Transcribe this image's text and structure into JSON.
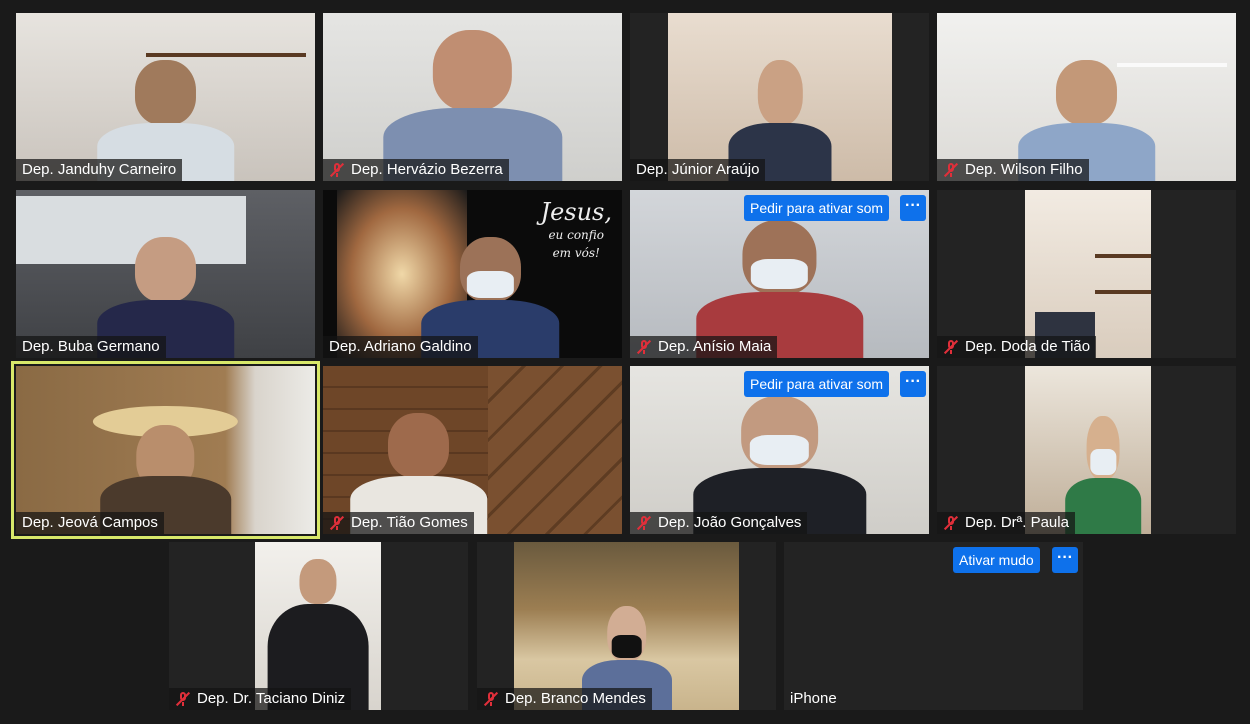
{
  "participants": [
    {
      "name": "Dep. Janduhy Carneiro",
      "muted": false
    },
    {
      "name": "Dep. Hervázio Bezerra",
      "muted": true
    },
    {
      "name": "Dep. Júnior Araújo",
      "muted": false
    },
    {
      "name": "Dep. Wilson Filho",
      "muted": true
    },
    {
      "name": "Dep. Buba Germano",
      "muted": false
    },
    {
      "name": "Dep. Adriano Galdino",
      "muted": false
    },
    {
      "name": "Dep. Anísio Maia",
      "muted": true
    },
    {
      "name": "Dep. Doda de Tião",
      "muted": true
    },
    {
      "name": "Dep. Jeová Campos",
      "muted": false,
      "active_speaker": true
    },
    {
      "name": "Dep. Tião Gomes",
      "muted": true
    },
    {
      "name": "Dep. João Gonçalves",
      "muted": true
    },
    {
      "name": "Dep. Drª. Paula",
      "muted": true
    },
    {
      "name": "Dep. Dr. Taciano Diniz",
      "muted": true
    },
    {
      "name": "Dep. Branco Mendes",
      "muted": true
    },
    {
      "name": "iPhone",
      "muted": false
    }
  ],
  "overlays": {
    "ask_unmute_label": "Pedir para ativar som",
    "mute_label": "Ativar mudo",
    "more_label": "···"
  },
  "background_text": {
    "jesus_title": "Jesus,",
    "jesus_line2": "eu confio",
    "jesus_line3": "em vós!"
  },
  "colors": {
    "background": "#1a1a1a",
    "active_speaker_border": "#d8e86a",
    "button_blue": "#0e71eb",
    "muted_red": "#e02f3a"
  }
}
